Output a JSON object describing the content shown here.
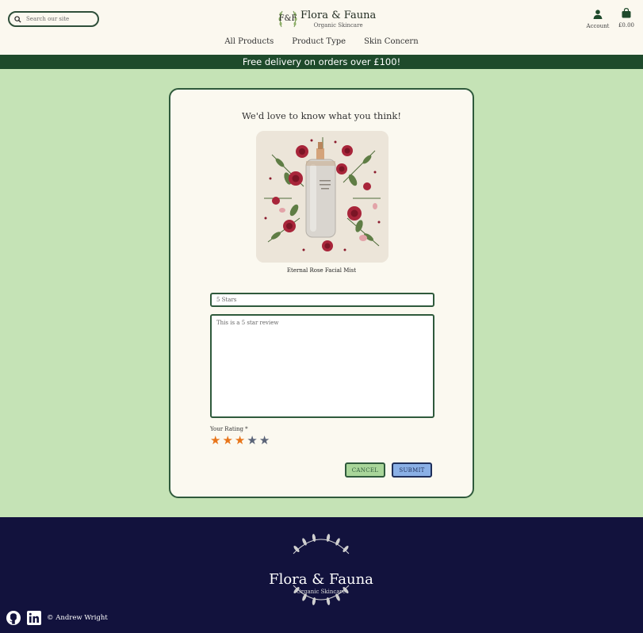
{
  "header": {
    "search_placeholder": "Search our site",
    "brand": {
      "name": "Flora & Fauna",
      "tagline": "Organic Skincare",
      "mark": "F&F"
    },
    "account_label": "Account",
    "bag_total": "£0.00",
    "nav": [
      "All Products",
      "Product Type",
      "Skin Concern"
    ]
  },
  "banner": "Free delivery on orders over £100!",
  "review_form": {
    "heading": "We'd love to know what you think!",
    "product_name": "Eternal Rose Facial Mist",
    "title_placeholder": "5 Stars",
    "body_placeholder": "This is a 5 star review",
    "rating_label": "Your Rating *",
    "rating": 3,
    "rating_max": 5,
    "star_on_color": "#e8751a",
    "star_off_color": "#5a6478",
    "cancel_label": "CANCEL",
    "submit_label": "SUBMIT"
  },
  "footer": {
    "brand_name": "Flora & Fauna",
    "brand_tagline": "Organic Skincare",
    "copyright": "© Andrew Wright",
    "social": [
      "github-icon",
      "linkedin-icon"
    ]
  }
}
